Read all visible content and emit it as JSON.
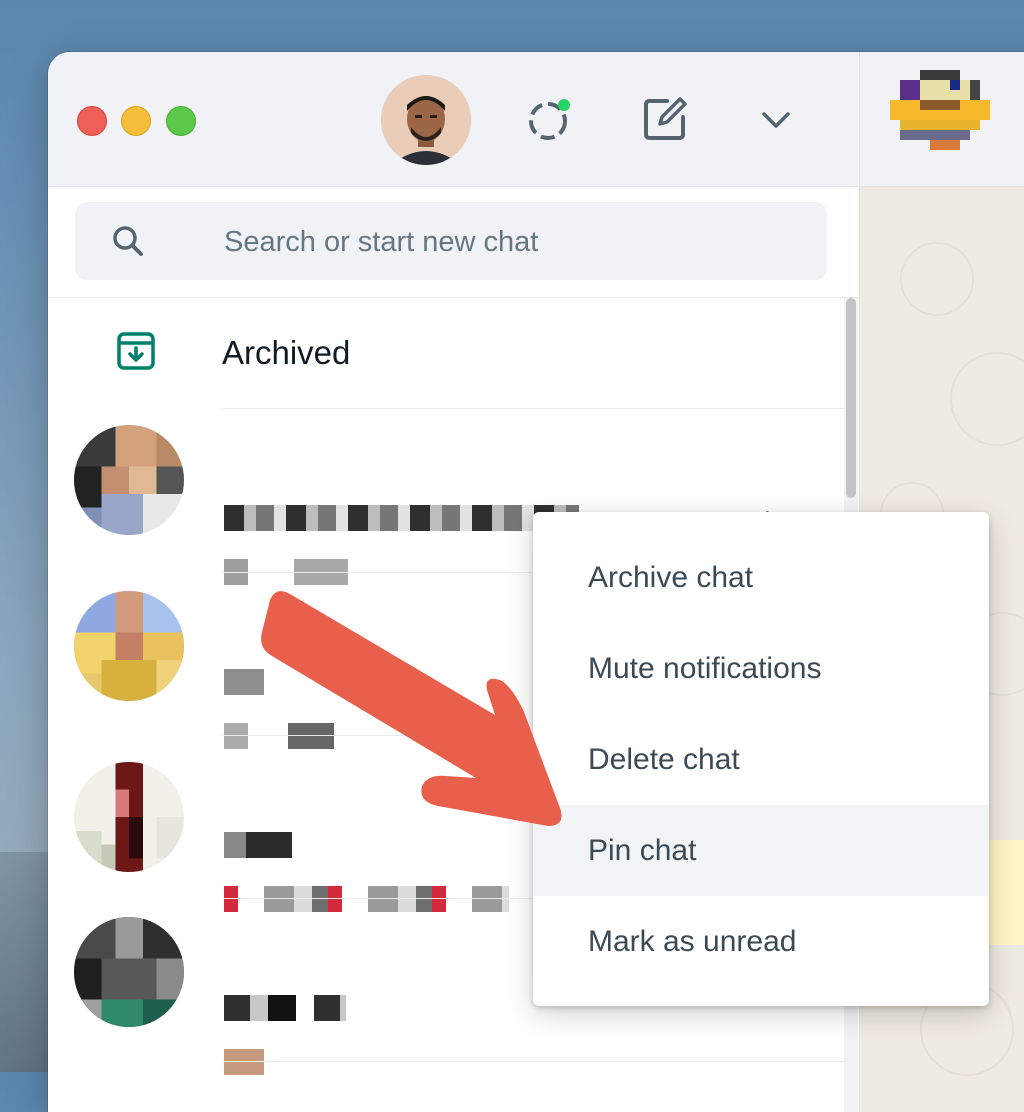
{
  "window": {
    "search": {
      "placeholder": "Search or start new chat"
    },
    "archived": {
      "label": "Archived"
    }
  },
  "chats": [
    {
      "time": "yesterday"
    },
    {
      "time": ""
    },
    {
      "time": ""
    },
    {
      "time": ""
    }
  ],
  "context_menu": {
    "items": [
      {
        "label": "Archive chat"
      },
      {
        "label": "Mute notifications"
      },
      {
        "label": "Delete chat"
      },
      {
        "label": "Pin chat",
        "highlighted": true
      },
      {
        "label": "Mark as unread"
      }
    ]
  },
  "colors": {
    "traffic_close": "#ee5f57",
    "traffic_minimize": "#f6bd3b",
    "traffic_maximize": "#5cc84a",
    "status_dot": "#25d366",
    "archive_icon": "#008069",
    "annotation_arrow": "#e8604c"
  },
  "icons": {
    "status": "status-icon",
    "compose": "new-chat-icon",
    "menu": "chevron-down-icon",
    "search": "search-icon",
    "archive": "archive-box-icon"
  }
}
